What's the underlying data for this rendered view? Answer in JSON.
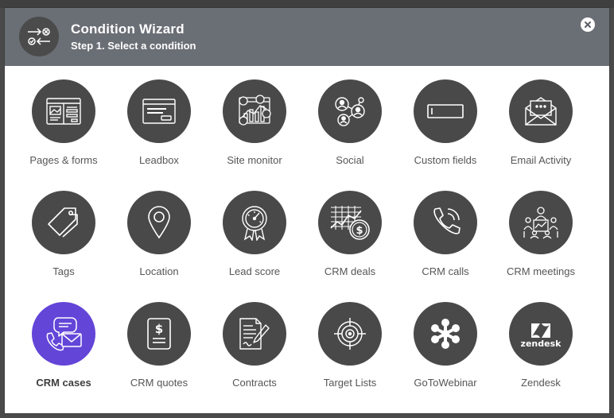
{
  "header": {
    "title": "Condition Wizard",
    "subtitle": "Step 1. Select a condition",
    "icon": "condition-arrows-icon",
    "close_icon": "close-icon"
  },
  "colors": {
    "header_bg": "#6a6e75",
    "tile_bg": "#494949",
    "active_tile_bg": "#6345d8",
    "label": "#565656"
  },
  "conditions": [
    {
      "label": "Pages & forms",
      "icon": "pages-forms-icon",
      "active": false
    },
    {
      "label": "Leadbox",
      "icon": "leadbox-icon",
      "active": false
    },
    {
      "label": "Site monitor",
      "icon": "site-monitor-icon",
      "active": false
    },
    {
      "label": "Social",
      "icon": "social-icon",
      "active": false
    },
    {
      "label": "Custom fields",
      "icon": "custom-fields-icon",
      "active": false
    },
    {
      "label": "Email Activity",
      "icon": "email-activity-icon",
      "active": false
    },
    {
      "label": "Tags",
      "icon": "tag-icon",
      "active": false
    },
    {
      "label": "Location",
      "icon": "location-pin-icon",
      "active": false
    },
    {
      "label": "Lead score",
      "icon": "lead-score-badge-icon",
      "active": false
    },
    {
      "label": "CRM deals",
      "icon": "crm-deals-icon",
      "active": false
    },
    {
      "label": "CRM calls",
      "icon": "phone-icon",
      "active": false
    },
    {
      "label": "CRM meetings",
      "icon": "meeting-icon",
      "active": false
    },
    {
      "label": "CRM cases",
      "icon": "crm-cases-icon",
      "active": true
    },
    {
      "label": "CRM quotes",
      "icon": "quote-document-icon",
      "active": false
    },
    {
      "label": "Contracts",
      "icon": "contract-icon",
      "active": false
    },
    {
      "label": "Target Lists",
      "icon": "target-icon",
      "active": false
    },
    {
      "label": "GoToWebinar",
      "icon": "gotowebinar-icon",
      "active": false
    },
    {
      "label": "Zendesk",
      "icon": "zendesk-icon",
      "active": false,
      "logo_text": "zendesk"
    }
  ]
}
